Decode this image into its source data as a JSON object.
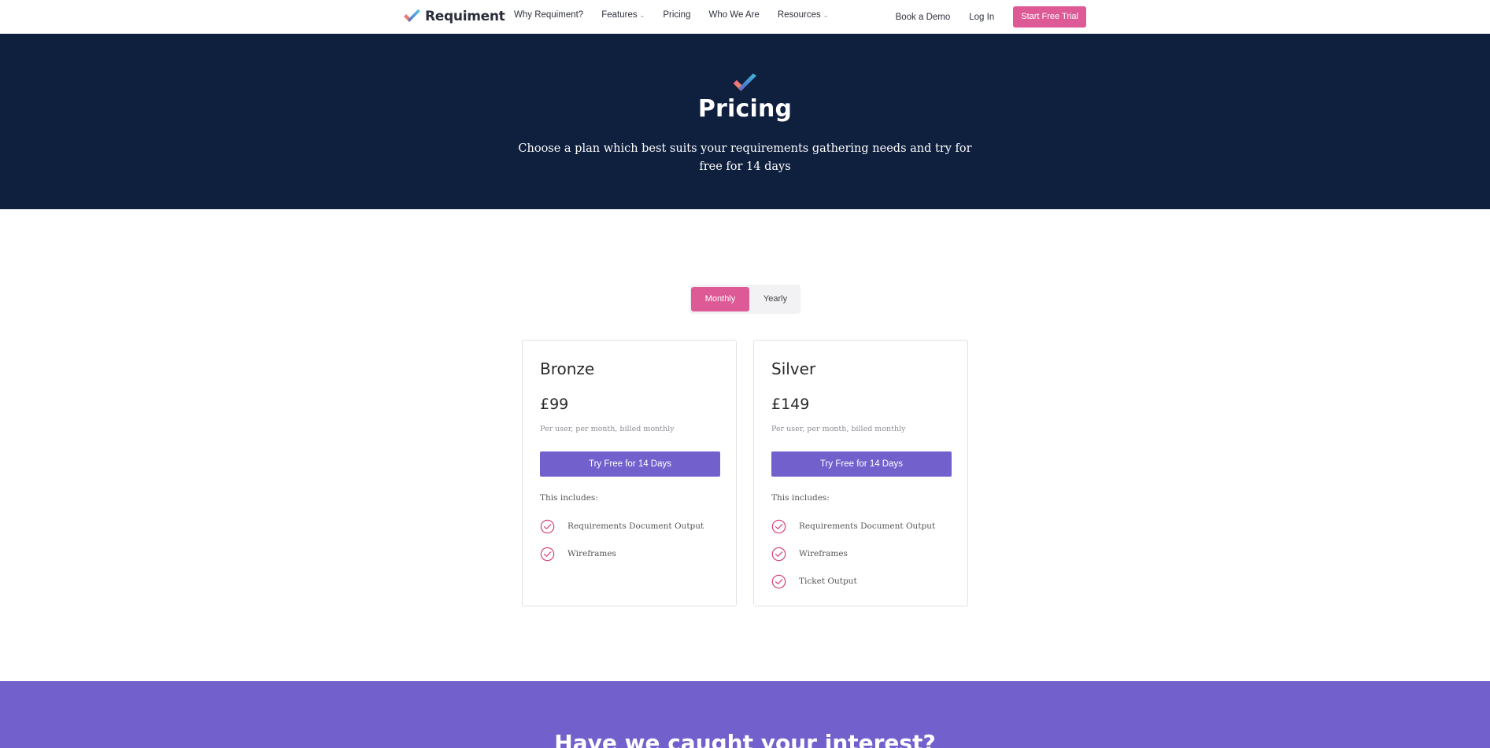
{
  "nav": {
    "brand": "Requiment",
    "links": [
      {
        "label": "Why Requiment?",
        "has_dropdown": false
      },
      {
        "label": "Features",
        "has_dropdown": true
      },
      {
        "label": "Pricing",
        "has_dropdown": false
      },
      {
        "label": "Who We Are",
        "has_dropdown": false
      },
      {
        "label": "Resources",
        "has_dropdown": true
      }
    ],
    "book_demo": "Book a Demo",
    "login": "Log In",
    "trial_button": "Start Free Trial"
  },
  "hero": {
    "title": "Pricing",
    "subtitle": "Choose a plan which best suits your requirements gathering needs and try for free for 14 days"
  },
  "billing_toggle": {
    "options": [
      "Monthly",
      "Yearly"
    ],
    "selected": "Monthly"
  },
  "plans": [
    {
      "name": "Bronze",
      "price": "£99",
      "billing": "Per user, per month, billed monthly",
      "cta": "Try Free for 14 Days",
      "includes_label": "This includes:",
      "features": [
        "Requirements Document Output",
        "Wireframes"
      ]
    },
    {
      "name": "Silver",
      "price": "£149",
      "billing": "Per user, per month, billed monthly",
      "cta": "Try Free for 14 Days",
      "includes_label": "This includes:",
      "features": [
        "Requirements Document Output",
        "Wireframes",
        "Ticket Output"
      ]
    }
  ],
  "cta_section": {
    "title": "Have we caught your interest?"
  },
  "colors": {
    "navy": "#0f1f3e",
    "pink": "#de5a96",
    "purple": "#7261cd"
  },
  "icons": {
    "logo": "checkmark-logo-icon",
    "feature": "circle-check-icon",
    "dropdown": "chevron-down-icon"
  }
}
